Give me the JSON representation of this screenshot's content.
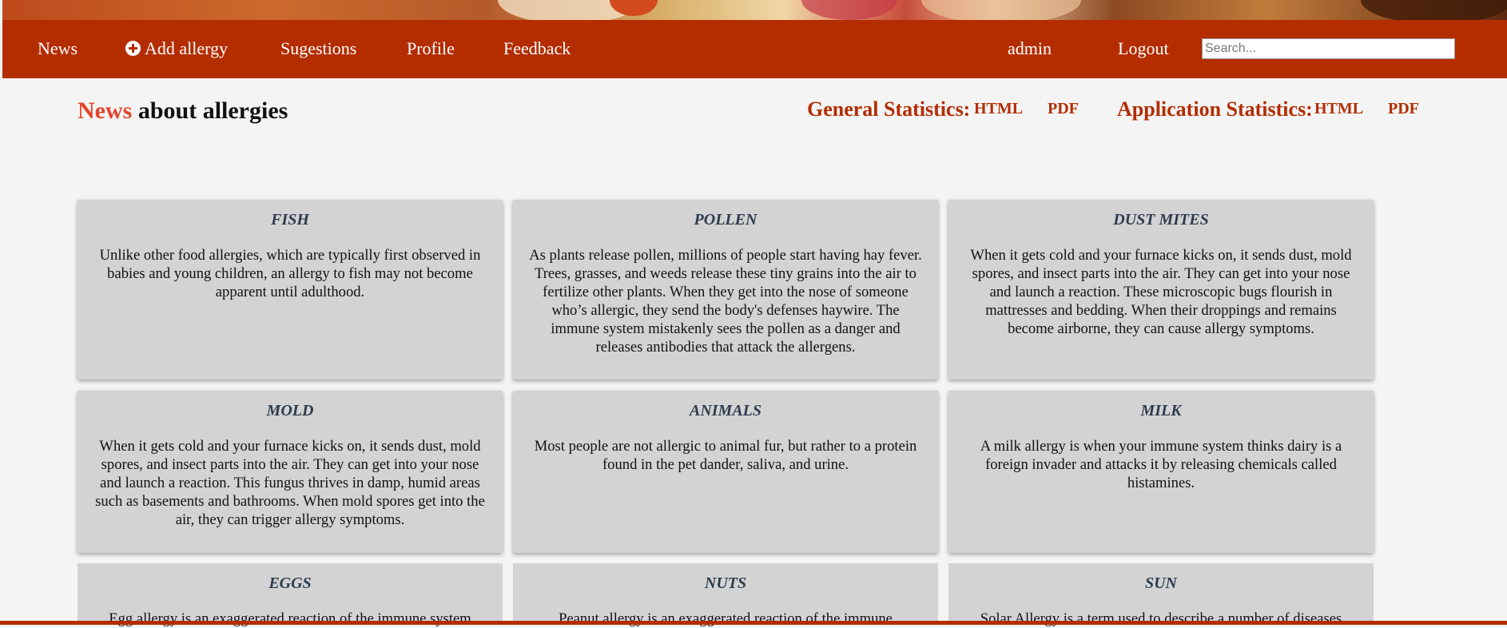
{
  "nav": {
    "news": "News",
    "add_allergy": "Add allergy",
    "suggestions": "Sugestions",
    "profile": "Profile",
    "feedback": "Feedback",
    "user": "admin",
    "logout": "Logout",
    "search_placeholder": "Search...",
    "add_icon": "plus-circle-icon"
  },
  "header": {
    "title_accent": "News",
    "title_rest": "about allergies"
  },
  "stats": {
    "general_label": "General Statistics:",
    "application_label": "Application Statistics:",
    "html": "HTML",
    "pdf": "PDF"
  },
  "cards": [
    {
      "title": "FISH",
      "text": "Unlike other food allergies, which are typically first observed in babies and young children, an allergy to fish may not become apparent until adulthood."
    },
    {
      "title": "POLLEN",
      "text": "As plants release pollen, millions of people start having hay fever. Trees, grasses, and weeds release these tiny grains into the air to fertilize other plants. When they get into the nose of someone who’s allergic, they send the body's defenses haywire. The immune system mistakenly sees the pollen as a danger and releases antibodies that attack the allergens."
    },
    {
      "title": "DUST MITES",
      "text": "When it gets cold and your furnace kicks on, it sends dust, mold spores, and insect parts into the air. They can get into your nose and launch a reaction. These microscopic bugs flourish in mattresses and bedding. When their droppings and remains become airborne, they can cause allergy symptoms."
    },
    {
      "title": "MOLD",
      "text": "When it gets cold and your furnace kicks on, it sends dust, mold spores, and insect parts into the air. They can get into your nose and launch a reaction. This fungus thrives in damp, humid areas such as basements and bathrooms. When mold spores get into the air, they can trigger allergy symptoms."
    },
    {
      "title": "ANIMALS",
      "text": "Most people are not allergic to animal fur, but rather to a protein found in the pet dander, saliva, and urine."
    },
    {
      "title": "MILK",
      "text": "A milk allergy is when your immune system thinks dairy is a foreign invader and attacks it by releasing chemicals called histamines."
    },
    {
      "title": "EGGS",
      "text": "Egg allergy is an exaggerated reaction of the immune system"
    },
    {
      "title": "NUTS",
      "text": "Peanut allergy is an exaggerated reaction of the immune"
    },
    {
      "title": "SUN",
      "text": "Solar Allergy is a term used to describe a number of diseases"
    }
  ],
  "colors": {
    "nav_bg": "#b32d00",
    "accent": "#e2442b",
    "card_bg": "#d3d3d3",
    "card_title": "#2e3b4e"
  }
}
